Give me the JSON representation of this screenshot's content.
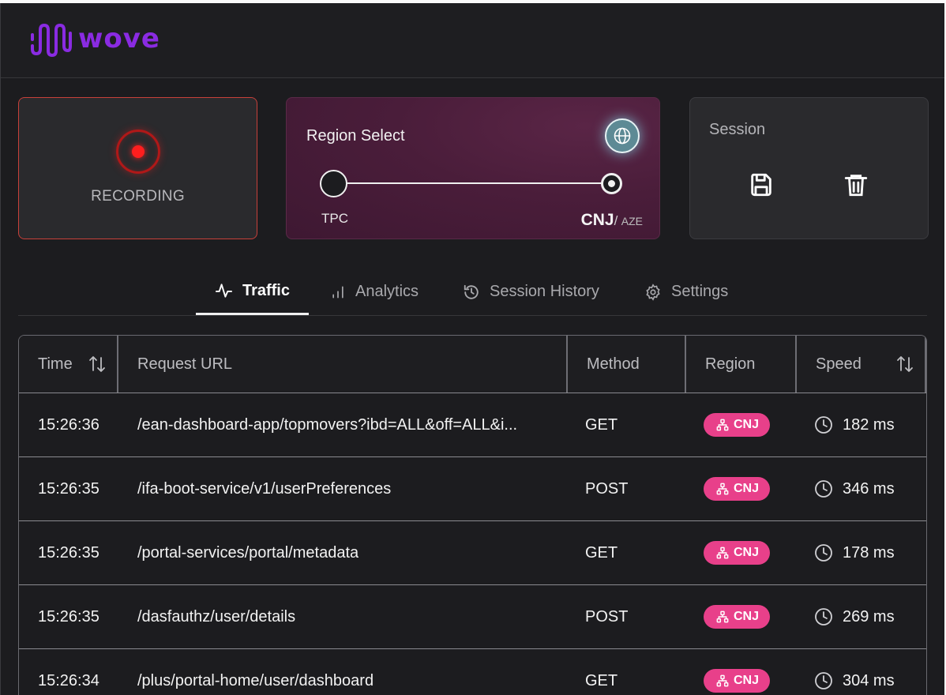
{
  "header": {
    "logo_text": "wove"
  },
  "recording": {
    "label": "RECORDING",
    "color": "#ff1e1e"
  },
  "region_select": {
    "title": "Region Select",
    "left_label": "TPC",
    "right_label_main": "CNJ",
    "right_label_sep": "/",
    "right_label_alt": "AZE",
    "selected": "CNJ"
  },
  "session": {
    "title": "Session",
    "save_icon": "save-icon",
    "delete_icon": "trash-icon"
  },
  "tabs": [
    {
      "label": "Traffic",
      "icon": "activity-icon",
      "active": true
    },
    {
      "label": "Analytics",
      "icon": "bar-chart-icon",
      "active": false
    },
    {
      "label": "Session History",
      "icon": "history-icon",
      "active": false
    },
    {
      "label": "Settings",
      "icon": "gear-icon",
      "active": false
    }
  ],
  "table": {
    "columns": {
      "time": "Time",
      "url": "Request URL",
      "method": "Method",
      "region": "Region",
      "speed": "Speed"
    },
    "rows": [
      {
        "time": "15:26:36",
        "url": "/ean-dashboard-app/topmovers?ibd=ALL&off=ALL&i...",
        "method": "GET",
        "region": "CNJ",
        "speed": "182 ms"
      },
      {
        "time": "15:26:35",
        "url": "/ifa-boot-service/v1/userPreferences",
        "method": "POST",
        "region": "CNJ",
        "speed": "346 ms"
      },
      {
        "time": "15:26:35",
        "url": "/portal-services/portal/metadata",
        "method": "GET",
        "region": "CNJ",
        "speed": "178 ms"
      },
      {
        "time": "15:26:35",
        "url": "/dasfauthz/user/details",
        "method": "POST",
        "region": "CNJ",
        "speed": "269 ms"
      },
      {
        "time": "15:26:34",
        "url": "/plus/portal-home/user/dashboard",
        "method": "GET",
        "region": "CNJ",
        "speed": "304 ms"
      }
    ]
  },
  "colors": {
    "accent": "#8a2be2",
    "badge": "#e8408a",
    "recording_border": "#c7403a"
  }
}
